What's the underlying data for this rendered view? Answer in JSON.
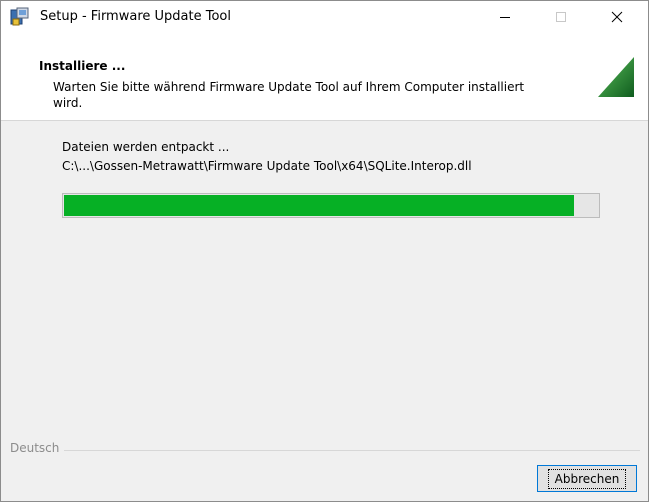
{
  "window": {
    "title": "Setup - Firmware Update Tool",
    "controls": {
      "minimize": "minimize-icon",
      "maximize": "maximize-icon",
      "close": "close-icon"
    }
  },
  "header": {
    "title": "Installiere ...",
    "description": "Warten Sie bitte während Firmware Update Tool auf Ihrem Computer installiert wird."
  },
  "body": {
    "status": "Dateien werden entpackt ...",
    "path": "C:\\...\\Gossen-Metrawatt\\Firmware Update Tool\\x64\\SQLite.Interop.dll",
    "progress_fraction": 0.955
  },
  "footer": {
    "language": "Deutsch",
    "cancel_label": "Abbrechen"
  },
  "colors": {
    "progress": "#06b025",
    "accent": "#0078d7",
    "header_graphic": "#1e7a2e"
  }
}
